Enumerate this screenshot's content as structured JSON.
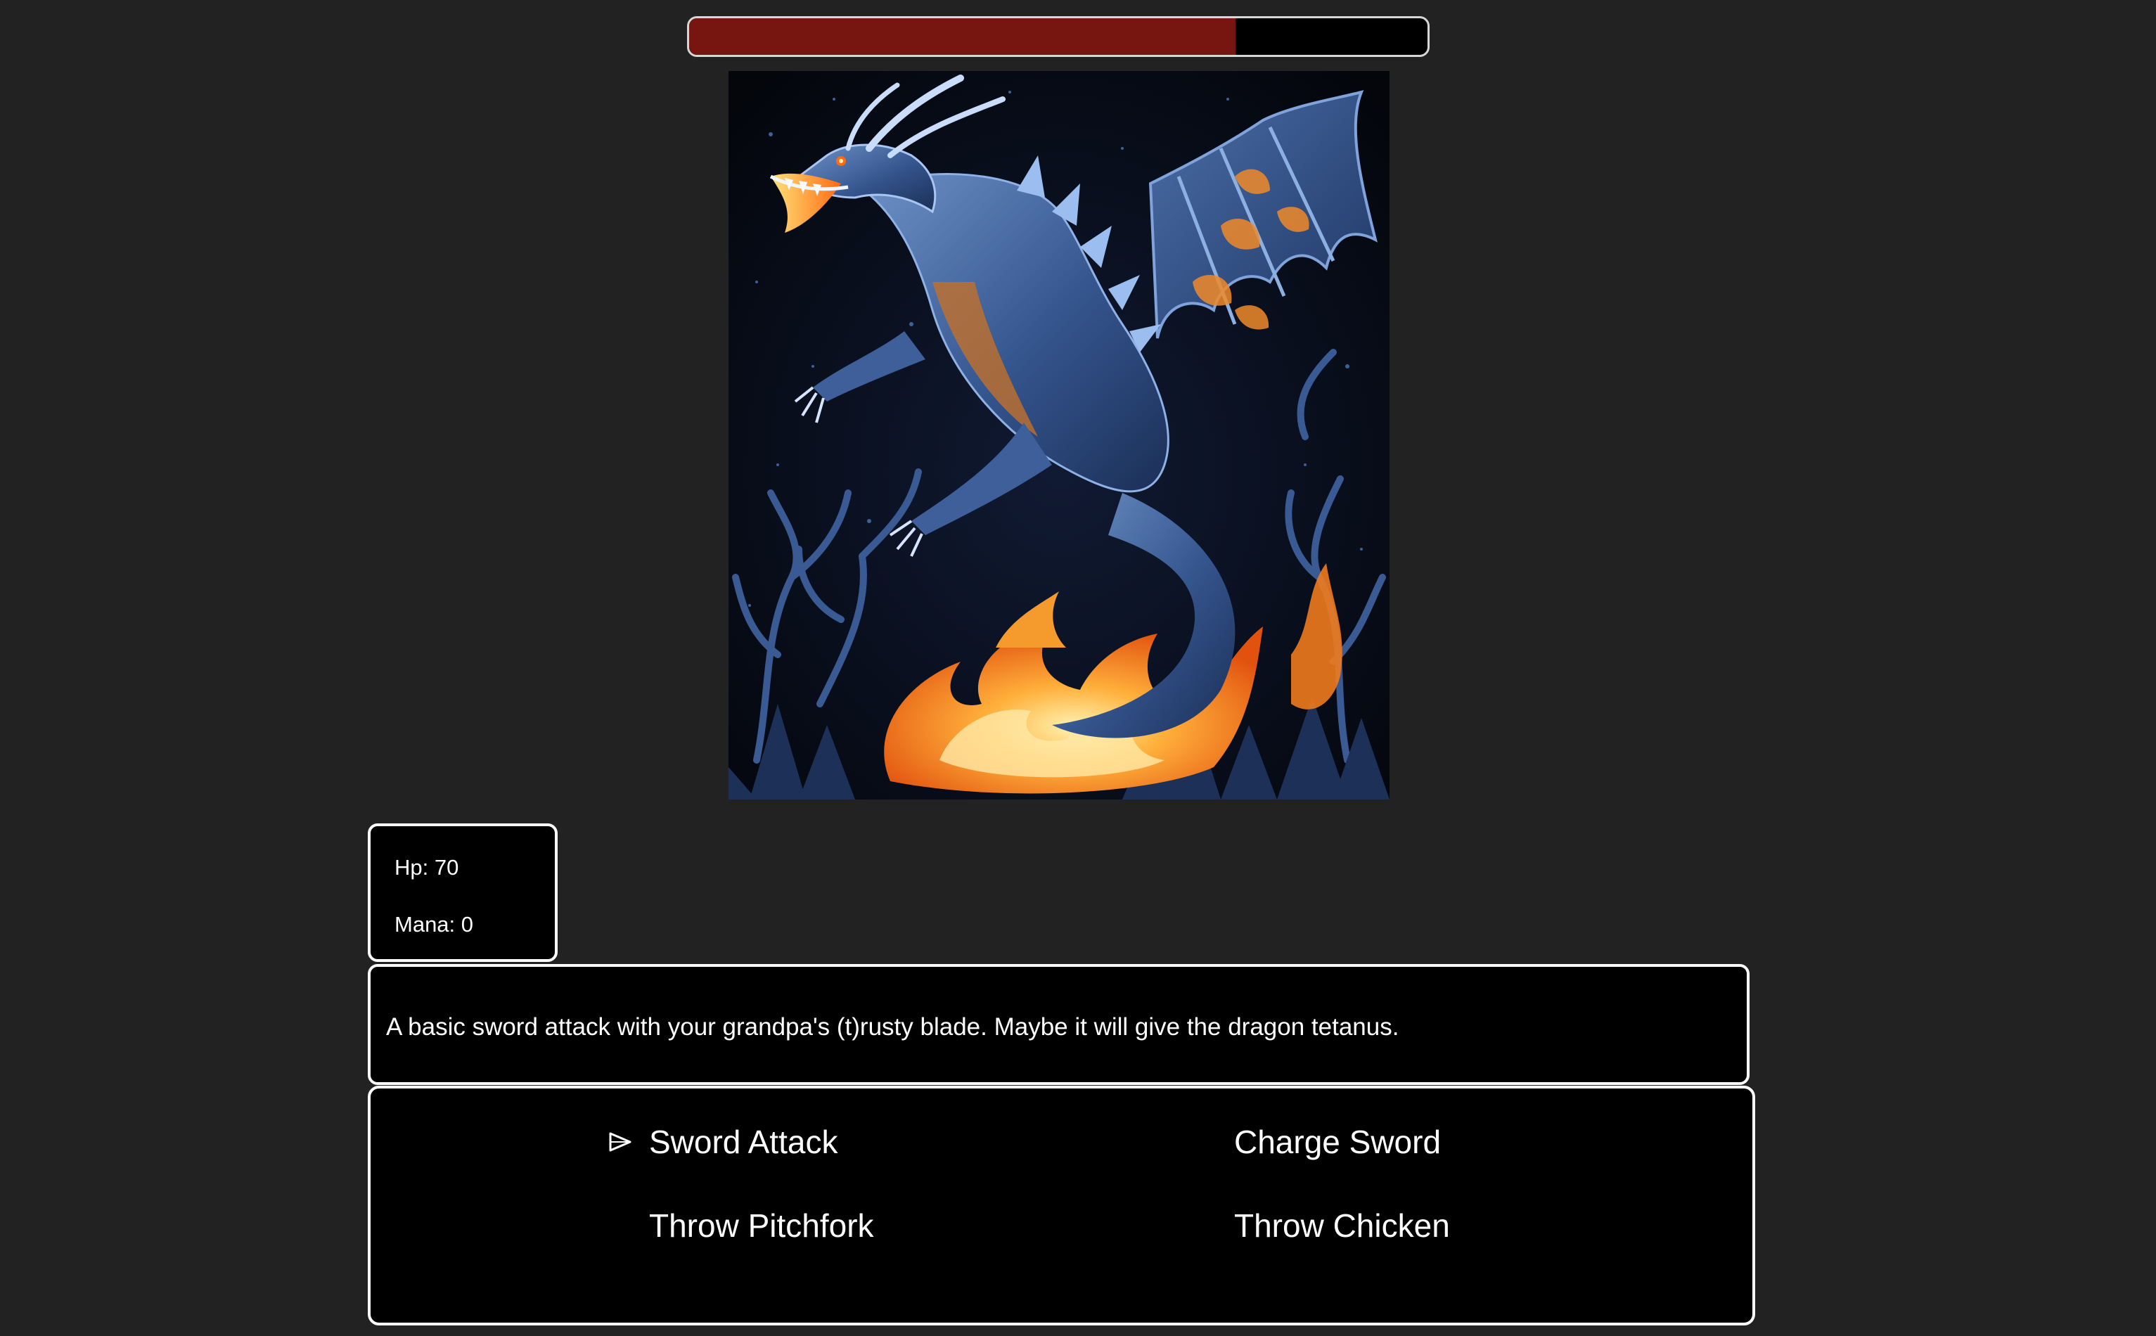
{
  "enemy": {
    "health_fraction": 0.74,
    "health_color": "#771610"
  },
  "image": {
    "subject": "blue dragon with flames",
    "icon": "dragon-image"
  },
  "player": {
    "hp_label": "Hp: 70",
    "mana_label": "Mana: 0"
  },
  "description": "A basic sword attack with your grandpa's (t)rusty blade. Maybe it will give the dragon tetanus.",
  "menu": {
    "selected_index": 0,
    "cursor_icon": "triangle-right-icon",
    "items": [
      {
        "label": "Sword Attack"
      },
      {
        "label": "Charge Sword"
      },
      {
        "label": "Throw Pitchfork"
      },
      {
        "label": "Throw Chicken"
      }
    ]
  }
}
